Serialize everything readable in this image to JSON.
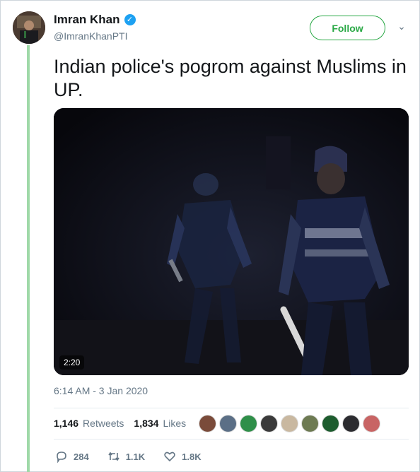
{
  "author": {
    "name": "Imran Khan",
    "handle": "@ImranKhanPTI",
    "verified_icon": "verified-badge-icon"
  },
  "follow_label": "Follow",
  "tweet": {
    "text": "Indian police's pogrom against Muslims in UP.",
    "video_duration": "2:20",
    "timestamp": "6:14 AM - 3 Jan 2020"
  },
  "stats": {
    "retweets_count": "1,146",
    "retweets_label": "Retweets",
    "likes_count": "1,834",
    "likes_label": "Likes"
  },
  "actions": {
    "replies": "284",
    "retweets": "1.1K",
    "likes": "1.8K"
  },
  "colors": {
    "follow_green": "#29a845",
    "verified_blue": "#1da1f2",
    "thread_line": "#9fd9a8"
  }
}
